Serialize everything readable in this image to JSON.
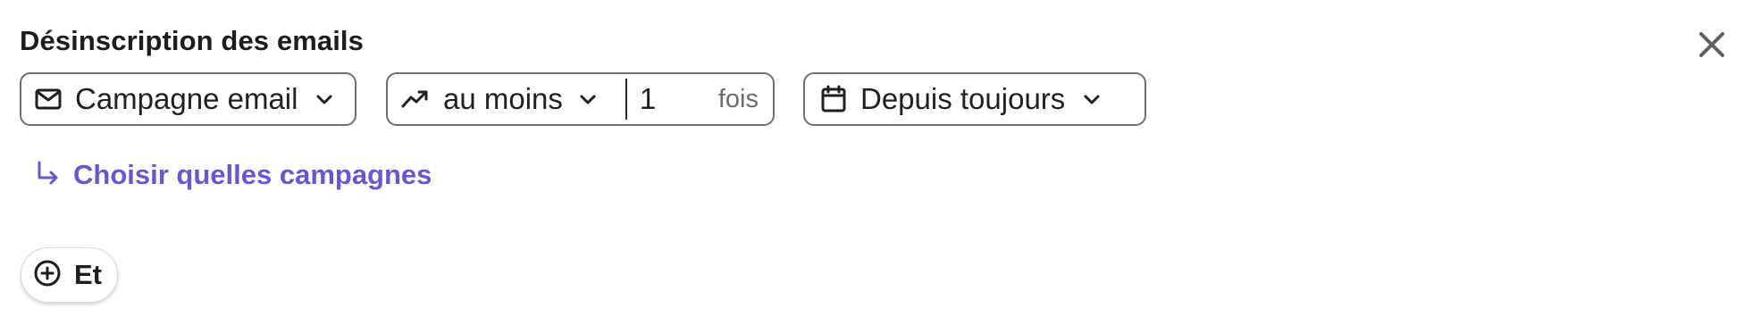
{
  "panel": {
    "title": "Désinscription des emails"
  },
  "filters": {
    "campaign": {
      "label": "Campagne email",
      "icon": "mail-icon"
    },
    "frequency": {
      "operator": "au moins",
      "count": "1",
      "unit": "fois",
      "icon": "trending-up-icon"
    },
    "period": {
      "label": "Depuis toujours",
      "icon": "calendar-icon"
    }
  },
  "choose_campaigns_link": {
    "label": "Choisir quelles campagnes",
    "icon": "arrow-down-right-icon"
  },
  "and_button": {
    "label": "Et",
    "icon": "plus-circle-icon"
  },
  "colors": {
    "accent": "#6a55d4",
    "border": "#6f6f74",
    "text": "#1f1f24",
    "muted": "#6b6b72"
  }
}
